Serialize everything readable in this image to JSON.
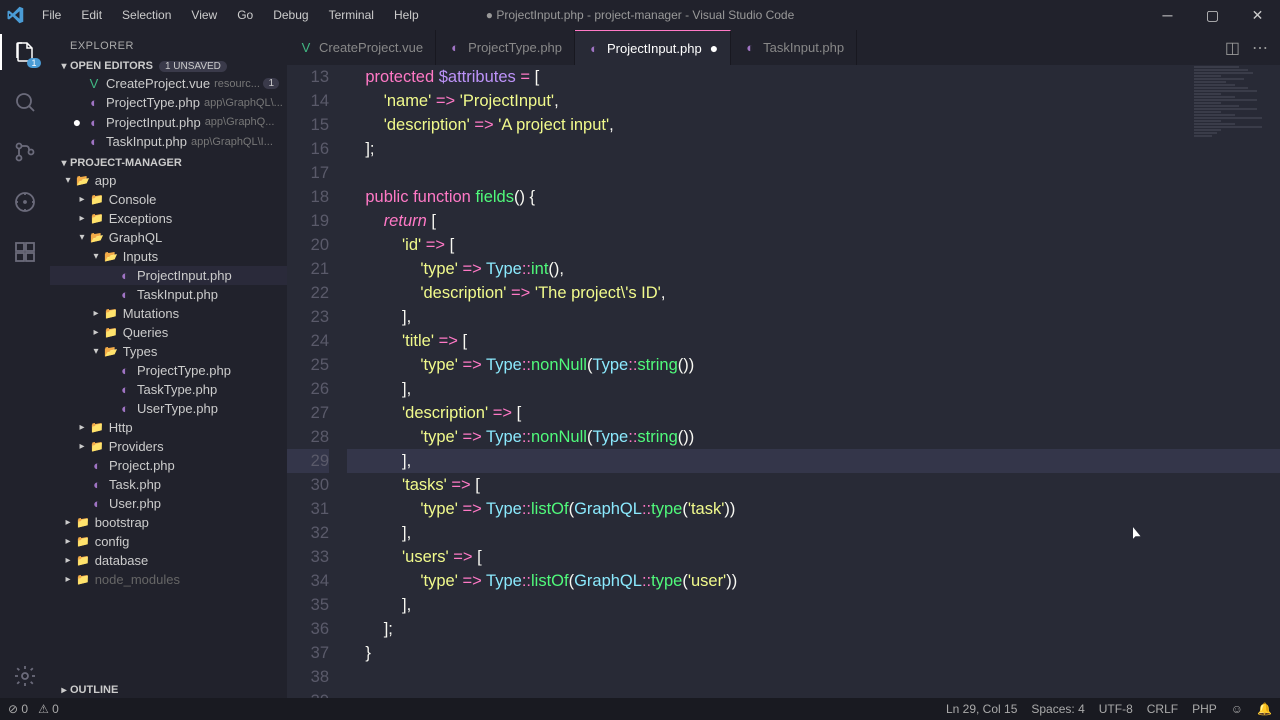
{
  "window": {
    "title": "● ProjectInput.php - project-manager - Visual Studio Code"
  },
  "menus": [
    "File",
    "Edit",
    "Selection",
    "View",
    "Go",
    "Debug",
    "Terminal",
    "Help"
  ],
  "activity": {
    "explorer_badge": "1"
  },
  "explorer": {
    "header": "EXPLORER",
    "open_editors_label": "OPEN EDITORS",
    "unsaved_badge": "1 UNSAVED",
    "editors": [
      {
        "name": "CreateProject.vue",
        "path": "resourc...",
        "icon": "vue",
        "num": "1"
      },
      {
        "name": "ProjectType.php",
        "path": "app\\GraphQL\\...",
        "icon": "php"
      },
      {
        "name": "ProjectInput.php",
        "path": "app\\GraphQ...",
        "icon": "php",
        "dirty": true
      },
      {
        "name": "TaskInput.php",
        "path": "app\\GraphQL\\I...",
        "icon": "php"
      }
    ],
    "project_label": "PROJECT-MANAGER",
    "outline_label": "OUTLINE"
  },
  "tree": [
    {
      "l": 1,
      "t": "folder",
      "open": true,
      "name": "app"
    },
    {
      "l": 2,
      "t": "folder",
      "open": false,
      "name": "Console"
    },
    {
      "l": 2,
      "t": "folder",
      "open": false,
      "name": "Exceptions"
    },
    {
      "l": 2,
      "t": "folder",
      "open": true,
      "name": "GraphQL"
    },
    {
      "l": 3,
      "t": "folder",
      "open": true,
      "name": "Inputs"
    },
    {
      "l": 4,
      "t": "file",
      "name": "ProjectInput.php",
      "icon": "php",
      "active": true
    },
    {
      "l": 4,
      "t": "file",
      "name": "TaskInput.php",
      "icon": "php"
    },
    {
      "l": 3,
      "t": "folder",
      "open": false,
      "name": "Mutations"
    },
    {
      "l": 3,
      "t": "folder",
      "open": false,
      "name": "Queries"
    },
    {
      "l": 3,
      "t": "folder",
      "open": true,
      "name": "Types"
    },
    {
      "l": 4,
      "t": "file",
      "name": "ProjectType.php",
      "icon": "php"
    },
    {
      "l": 4,
      "t": "file",
      "name": "TaskType.php",
      "icon": "php"
    },
    {
      "l": 4,
      "t": "file",
      "name": "UserType.php",
      "icon": "php"
    },
    {
      "l": 2,
      "t": "folder",
      "open": false,
      "name": "Http"
    },
    {
      "l": 2,
      "t": "folder",
      "open": false,
      "name": "Providers",
      "color": "green"
    },
    {
      "l": 2,
      "t": "file",
      "name": "Project.php",
      "icon": "php"
    },
    {
      "l": 2,
      "t": "file",
      "name": "Task.php",
      "icon": "php"
    },
    {
      "l": 2,
      "t": "file",
      "name": "User.php",
      "icon": "php"
    },
    {
      "l": 1,
      "t": "folder",
      "open": false,
      "name": "bootstrap"
    },
    {
      "l": 1,
      "t": "folder",
      "open": false,
      "name": "config"
    },
    {
      "l": 1,
      "t": "folder",
      "open": false,
      "name": "database"
    },
    {
      "l": 1,
      "t": "folder",
      "open": false,
      "name": "node_modules",
      "muted": true
    }
  ],
  "tabs": [
    {
      "name": "CreateProject.vue",
      "icon": "vue"
    },
    {
      "name": "ProjectType.php",
      "icon": "php"
    },
    {
      "name": "ProjectInput.php",
      "icon": "php",
      "active": true,
      "dirty": true
    },
    {
      "name": "TaskInput.php",
      "icon": "php"
    }
  ],
  "code": {
    "first_line": 13,
    "highlight_line": 29
  },
  "statusbar": {
    "errors": "0",
    "warnings": "0",
    "ln_col": "Ln 29, Col 15",
    "spaces": "Spaces: 4",
    "encoding": "UTF-8",
    "eol": "CRLF",
    "lang": "PHP"
  },
  "chart_data": null
}
